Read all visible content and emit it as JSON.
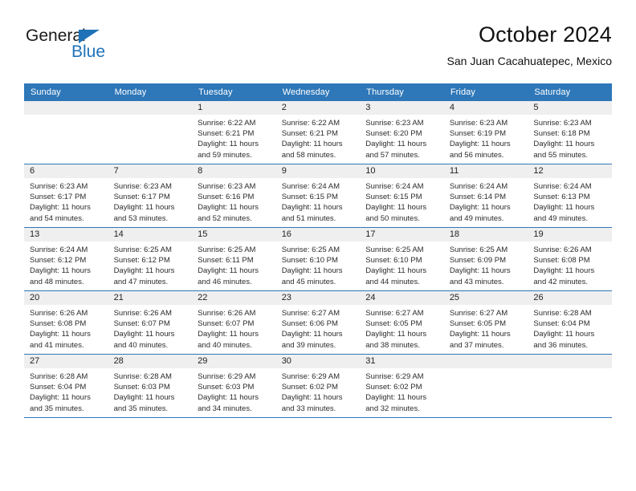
{
  "brand": {
    "name_top": "General",
    "name_bottom": "Blue",
    "accent_color": "#1f72b8"
  },
  "header": {
    "title": "October 2024",
    "subtitle": "San Juan Cacahuatepec, Mexico"
  },
  "theme": {
    "header_row_bg": "#2e77b8",
    "daynum_band_bg": "#efefef",
    "row_divider": "#2e77b8"
  },
  "weekday_headers": [
    "Sunday",
    "Monday",
    "Tuesday",
    "Wednesday",
    "Thursday",
    "Friday",
    "Saturday"
  ],
  "weeks": [
    [
      {
        "day": "",
        "sunrise": "",
        "sunset": "",
        "daylight_1": "",
        "daylight_2": ""
      },
      {
        "day": "",
        "sunrise": "",
        "sunset": "",
        "daylight_1": "",
        "daylight_2": ""
      },
      {
        "day": "1",
        "sunrise": "Sunrise: 6:22 AM",
        "sunset": "Sunset: 6:21 PM",
        "daylight_1": "Daylight: 11 hours",
        "daylight_2": "and 59 minutes."
      },
      {
        "day": "2",
        "sunrise": "Sunrise: 6:22 AM",
        "sunset": "Sunset: 6:21 PM",
        "daylight_1": "Daylight: 11 hours",
        "daylight_2": "and 58 minutes."
      },
      {
        "day": "3",
        "sunrise": "Sunrise: 6:23 AM",
        "sunset": "Sunset: 6:20 PM",
        "daylight_1": "Daylight: 11 hours",
        "daylight_2": "and 57 minutes."
      },
      {
        "day": "4",
        "sunrise": "Sunrise: 6:23 AM",
        "sunset": "Sunset: 6:19 PM",
        "daylight_1": "Daylight: 11 hours",
        "daylight_2": "and 56 minutes."
      },
      {
        "day": "5",
        "sunrise": "Sunrise: 6:23 AM",
        "sunset": "Sunset: 6:18 PM",
        "daylight_1": "Daylight: 11 hours",
        "daylight_2": "and 55 minutes."
      }
    ],
    [
      {
        "day": "6",
        "sunrise": "Sunrise: 6:23 AM",
        "sunset": "Sunset: 6:17 PM",
        "daylight_1": "Daylight: 11 hours",
        "daylight_2": "and 54 minutes."
      },
      {
        "day": "7",
        "sunrise": "Sunrise: 6:23 AM",
        "sunset": "Sunset: 6:17 PM",
        "daylight_1": "Daylight: 11 hours",
        "daylight_2": "and 53 minutes."
      },
      {
        "day": "8",
        "sunrise": "Sunrise: 6:23 AM",
        "sunset": "Sunset: 6:16 PM",
        "daylight_1": "Daylight: 11 hours",
        "daylight_2": "and 52 minutes."
      },
      {
        "day": "9",
        "sunrise": "Sunrise: 6:24 AM",
        "sunset": "Sunset: 6:15 PM",
        "daylight_1": "Daylight: 11 hours",
        "daylight_2": "and 51 minutes."
      },
      {
        "day": "10",
        "sunrise": "Sunrise: 6:24 AM",
        "sunset": "Sunset: 6:15 PM",
        "daylight_1": "Daylight: 11 hours",
        "daylight_2": "and 50 minutes."
      },
      {
        "day": "11",
        "sunrise": "Sunrise: 6:24 AM",
        "sunset": "Sunset: 6:14 PM",
        "daylight_1": "Daylight: 11 hours",
        "daylight_2": "and 49 minutes."
      },
      {
        "day": "12",
        "sunrise": "Sunrise: 6:24 AM",
        "sunset": "Sunset: 6:13 PM",
        "daylight_1": "Daylight: 11 hours",
        "daylight_2": "and 49 minutes."
      }
    ],
    [
      {
        "day": "13",
        "sunrise": "Sunrise: 6:24 AM",
        "sunset": "Sunset: 6:12 PM",
        "daylight_1": "Daylight: 11 hours",
        "daylight_2": "and 48 minutes."
      },
      {
        "day": "14",
        "sunrise": "Sunrise: 6:25 AM",
        "sunset": "Sunset: 6:12 PM",
        "daylight_1": "Daylight: 11 hours",
        "daylight_2": "and 47 minutes."
      },
      {
        "day": "15",
        "sunrise": "Sunrise: 6:25 AM",
        "sunset": "Sunset: 6:11 PM",
        "daylight_1": "Daylight: 11 hours",
        "daylight_2": "and 46 minutes."
      },
      {
        "day": "16",
        "sunrise": "Sunrise: 6:25 AM",
        "sunset": "Sunset: 6:10 PM",
        "daylight_1": "Daylight: 11 hours",
        "daylight_2": "and 45 minutes."
      },
      {
        "day": "17",
        "sunrise": "Sunrise: 6:25 AM",
        "sunset": "Sunset: 6:10 PM",
        "daylight_1": "Daylight: 11 hours",
        "daylight_2": "and 44 minutes."
      },
      {
        "day": "18",
        "sunrise": "Sunrise: 6:25 AM",
        "sunset": "Sunset: 6:09 PM",
        "daylight_1": "Daylight: 11 hours",
        "daylight_2": "and 43 minutes."
      },
      {
        "day": "19",
        "sunrise": "Sunrise: 6:26 AM",
        "sunset": "Sunset: 6:08 PM",
        "daylight_1": "Daylight: 11 hours",
        "daylight_2": "and 42 minutes."
      }
    ],
    [
      {
        "day": "20",
        "sunrise": "Sunrise: 6:26 AM",
        "sunset": "Sunset: 6:08 PM",
        "daylight_1": "Daylight: 11 hours",
        "daylight_2": "and 41 minutes."
      },
      {
        "day": "21",
        "sunrise": "Sunrise: 6:26 AM",
        "sunset": "Sunset: 6:07 PM",
        "daylight_1": "Daylight: 11 hours",
        "daylight_2": "and 40 minutes."
      },
      {
        "day": "22",
        "sunrise": "Sunrise: 6:26 AM",
        "sunset": "Sunset: 6:07 PM",
        "daylight_1": "Daylight: 11 hours",
        "daylight_2": "and 40 minutes."
      },
      {
        "day": "23",
        "sunrise": "Sunrise: 6:27 AM",
        "sunset": "Sunset: 6:06 PM",
        "daylight_1": "Daylight: 11 hours",
        "daylight_2": "and 39 minutes."
      },
      {
        "day": "24",
        "sunrise": "Sunrise: 6:27 AM",
        "sunset": "Sunset: 6:05 PM",
        "daylight_1": "Daylight: 11 hours",
        "daylight_2": "and 38 minutes."
      },
      {
        "day": "25",
        "sunrise": "Sunrise: 6:27 AM",
        "sunset": "Sunset: 6:05 PM",
        "daylight_1": "Daylight: 11 hours",
        "daylight_2": "and 37 minutes."
      },
      {
        "day": "26",
        "sunrise": "Sunrise: 6:28 AM",
        "sunset": "Sunset: 6:04 PM",
        "daylight_1": "Daylight: 11 hours",
        "daylight_2": "and 36 minutes."
      }
    ],
    [
      {
        "day": "27",
        "sunrise": "Sunrise: 6:28 AM",
        "sunset": "Sunset: 6:04 PM",
        "daylight_1": "Daylight: 11 hours",
        "daylight_2": "and 35 minutes."
      },
      {
        "day": "28",
        "sunrise": "Sunrise: 6:28 AM",
        "sunset": "Sunset: 6:03 PM",
        "daylight_1": "Daylight: 11 hours",
        "daylight_2": "and 35 minutes."
      },
      {
        "day": "29",
        "sunrise": "Sunrise: 6:29 AM",
        "sunset": "Sunset: 6:03 PM",
        "daylight_1": "Daylight: 11 hours",
        "daylight_2": "and 34 minutes."
      },
      {
        "day": "30",
        "sunrise": "Sunrise: 6:29 AM",
        "sunset": "Sunset: 6:02 PM",
        "daylight_1": "Daylight: 11 hours",
        "daylight_2": "and 33 minutes."
      },
      {
        "day": "31",
        "sunrise": "Sunrise: 6:29 AM",
        "sunset": "Sunset: 6:02 PM",
        "daylight_1": "Daylight: 11 hours",
        "daylight_2": "and 32 minutes."
      },
      {
        "day": "",
        "sunrise": "",
        "sunset": "",
        "daylight_1": "",
        "daylight_2": ""
      },
      {
        "day": "",
        "sunrise": "",
        "sunset": "",
        "daylight_1": "",
        "daylight_2": ""
      }
    ]
  ]
}
